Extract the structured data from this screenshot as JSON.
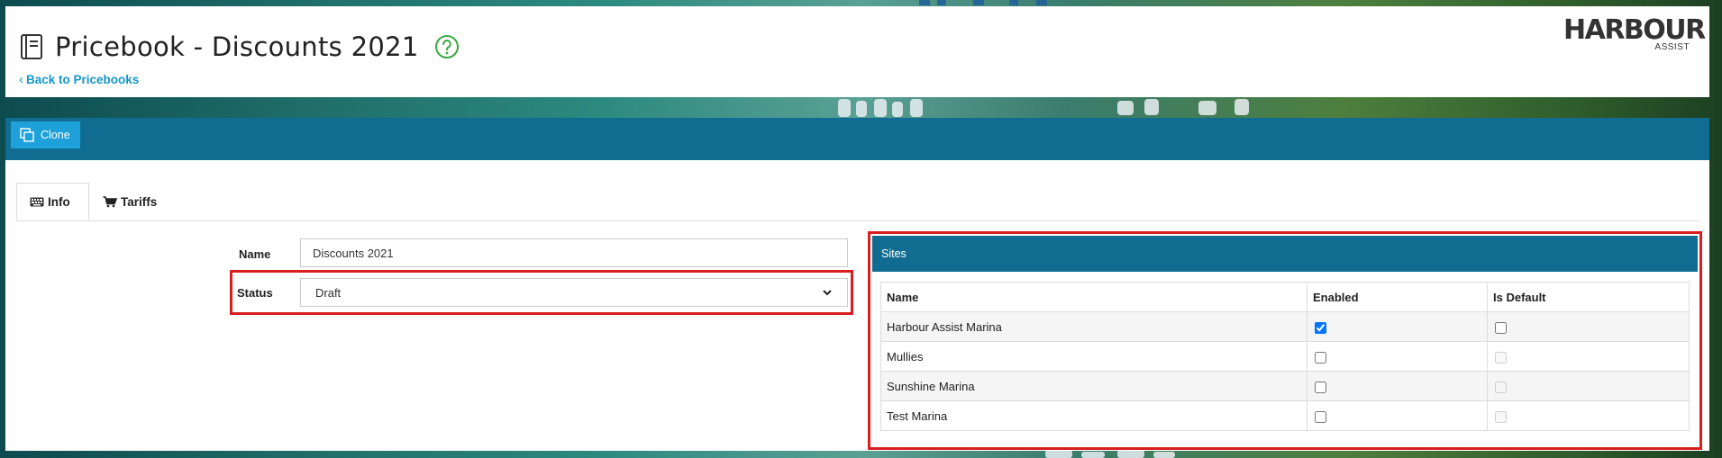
{
  "header": {
    "title": "Pricebook - Discounts 2021",
    "back_link": "Back to Pricebooks",
    "logo_brand": "HARBOUR",
    "logo_sub": "ASSIST",
    "help_color": "#3aa843"
  },
  "toolbar": {
    "clone_label": "Clone"
  },
  "tabs": [
    {
      "label": "Info",
      "icon": "keyboard-icon",
      "active": true
    },
    {
      "label": "Tariffs",
      "icon": "cart-icon",
      "active": false
    }
  ],
  "form": {
    "name_label": "Name",
    "name_value": "Discounts 2021",
    "status_label": "Status",
    "status_value": "Draft"
  },
  "sites": {
    "title": "Sites",
    "columns": [
      "Name",
      "Enabled",
      "Is Default"
    ],
    "rows": [
      {
        "name": "Harbour Assist Marina",
        "enabled": true,
        "is_default": false,
        "default_disabled": false
      },
      {
        "name": "Mullies",
        "enabled": false,
        "is_default": false,
        "default_disabled": true
      },
      {
        "name": "Sunshine Marina",
        "enabled": false,
        "is_default": false,
        "default_disabled": true
      },
      {
        "name": "Test Marina",
        "enabled": false,
        "is_default": false,
        "default_disabled": true
      }
    ]
  },
  "colors": {
    "accent": "#106d91",
    "button": "#1da1d8",
    "link": "#1596c9",
    "highlight": "#d71f1f"
  }
}
